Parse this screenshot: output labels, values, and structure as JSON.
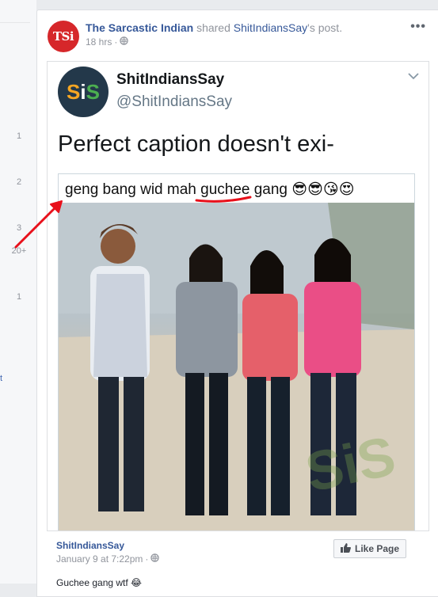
{
  "left_column": {
    "numbers": [
      "1",
      "2",
      "3",
      "20+",
      "1"
    ],
    "edge_text": "t"
  },
  "post": {
    "author": "The Sarcastic Indian",
    "avatar_text": "TSi",
    "shared_text": "shared",
    "source_page": "ShitIndiansSay",
    "source_suffix": "'s post.",
    "time": "18 hrs",
    "time_separator": "·",
    "privacy_icon": "globe-icon",
    "menu_icon": "more-icon"
  },
  "tweet": {
    "display_name": "ShitIndiansSay",
    "handle": "@ShitIndiansSay",
    "logo_text": [
      "S",
      "i",
      "S"
    ],
    "text": "Perfect caption doesn't exi-",
    "meme_caption": "geng bang wid mah guchee gang 😎😎😘😍",
    "watermark": "SiS"
  },
  "shared_page": {
    "name": "ShitIndiansSay",
    "date": "January 9 at 7:22pm",
    "date_separator": "·",
    "like_button": "Like Page",
    "caption": "Guchee gang wtf 😂"
  },
  "colors": {
    "annotation_red": "#e8101b",
    "link_blue": "#365899",
    "brand_red": "#d6272a"
  }
}
